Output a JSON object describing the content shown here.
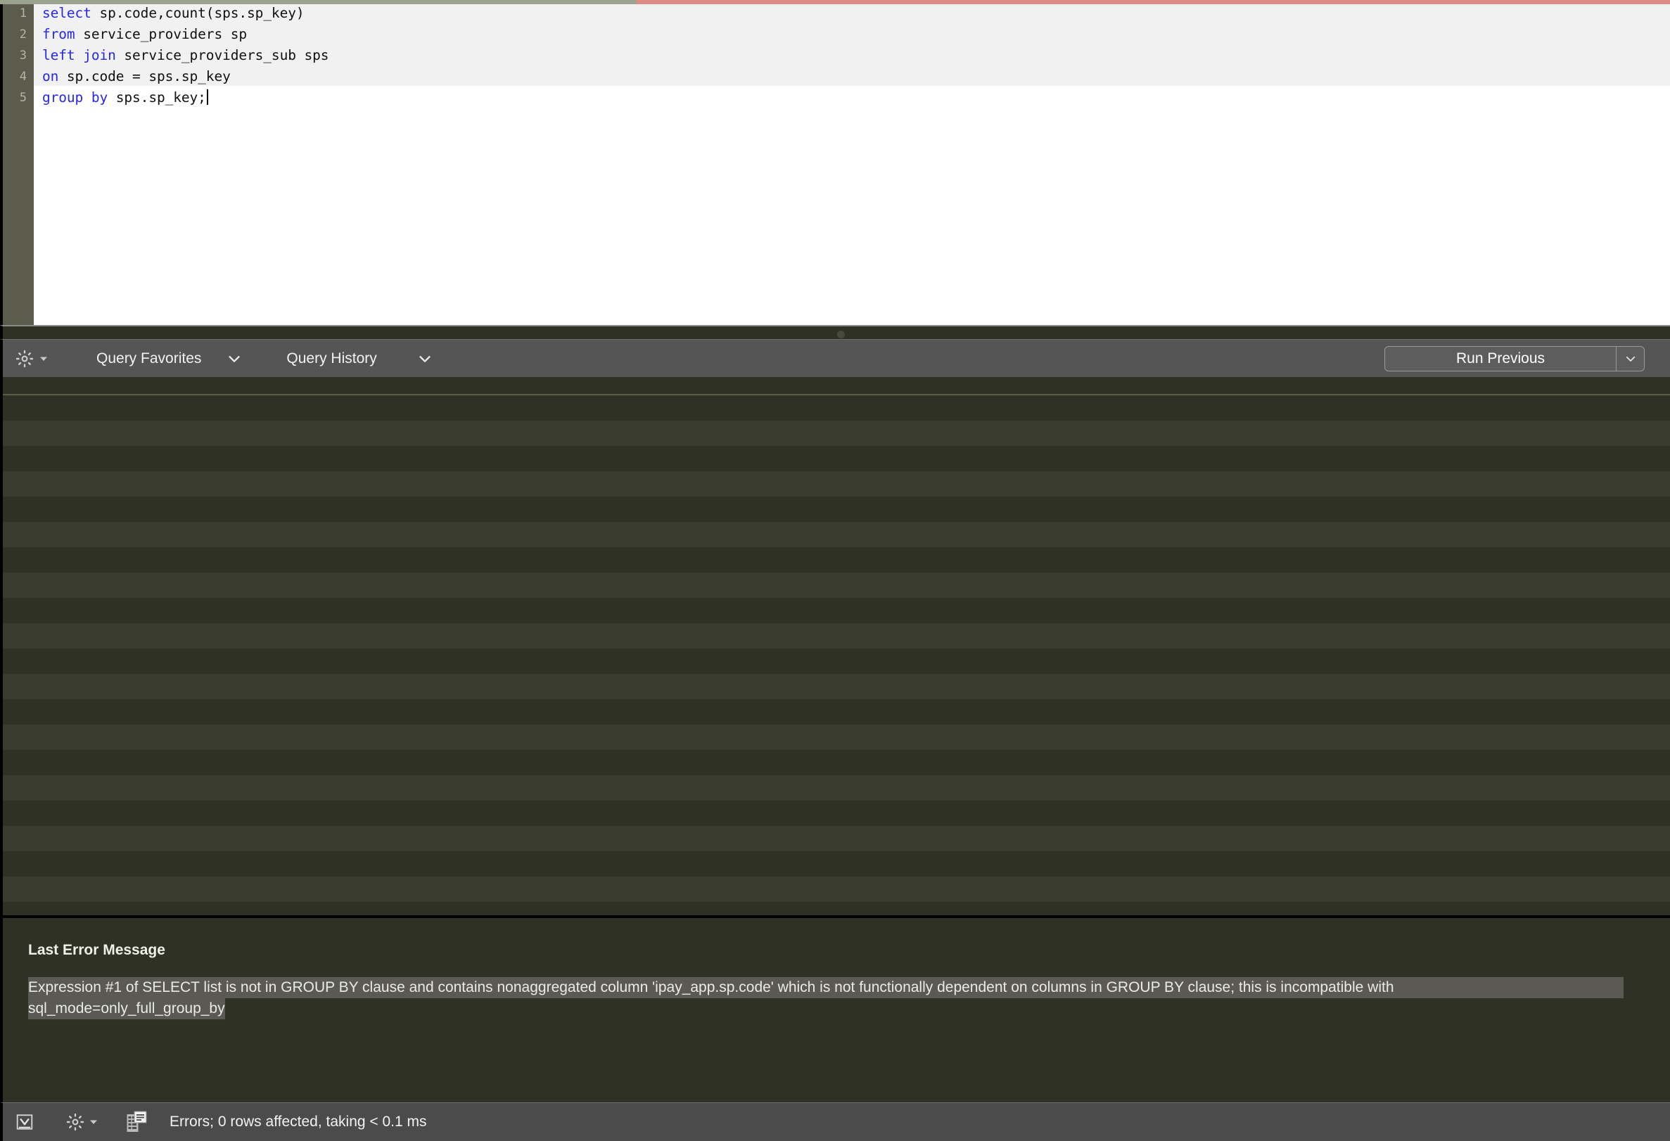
{
  "editor": {
    "gutter_numbers": [
      "1",
      "2",
      "3",
      "4",
      "5"
    ],
    "lines": [
      {
        "keyword": "select",
        "rest": " sp.code,count(sps.sp_key)"
      },
      {
        "keyword": "from",
        "rest": " service_providers sp"
      },
      {
        "keyword": "left join",
        "rest": " service_providers_sub sps"
      },
      {
        "keyword": "on",
        "rest": " sp.code = sps.sp_key"
      },
      {
        "keyword": "group by",
        "rest": " sps.sp_key;"
      }
    ],
    "full_text": "select sp.code,count(sps.sp_key)\nfrom service_providers sp\nleft join service_providers_sub sps\non sp.code = sps.sp_key\ngroup by sps.sp_key;"
  },
  "query_toolbar": {
    "settings_icon": "gear-icon",
    "settings_chevron": "chevron-down-icon",
    "favorites_label": "Query Favorites",
    "favorites_chevron": "chevron-down-icon",
    "history_label": "Query History",
    "history_chevron": "chevron-down-icon",
    "run_previous_label": "Run Previous",
    "run_previous_chevron": "chevron-down-icon"
  },
  "results": {
    "row_count": 20,
    "rows_visible": true
  },
  "error_panel": {
    "title": "Last Error Message",
    "message_line_1": "Expression #1 of SELECT list is not in GROUP BY clause and contains nonaggregated column 'ipay_app.sp.code' which is not functionally dependent on columns in GROUP BY clause; this is incompatible with",
    "message_line_2": "sql_mode=only_full_group_by"
  },
  "status_bar": {
    "export_icon": "export-down-icon",
    "settings_icon": "gear-icon",
    "settings_chevron": "chevron-down-icon",
    "grid_view_icon": "grid-document-icon",
    "status_text": "Errors; 0 rows affected, taking < 0.1 ms"
  },
  "colors": {
    "editor_background": "#ffffff",
    "editor_highlight": "#f1f1f1",
    "keyword_blue": "#2727e8",
    "gutter": "#5c5c4c",
    "grid_row_odd": "#2f3125",
    "grid_row_even": "#3a3c2e",
    "toolbar": "#555555",
    "status_bar": "#4b4b4b",
    "accent_red": "#dc8b85",
    "accent_sage": "#9aa38e",
    "selection_highlight": "#5a5a52"
  }
}
